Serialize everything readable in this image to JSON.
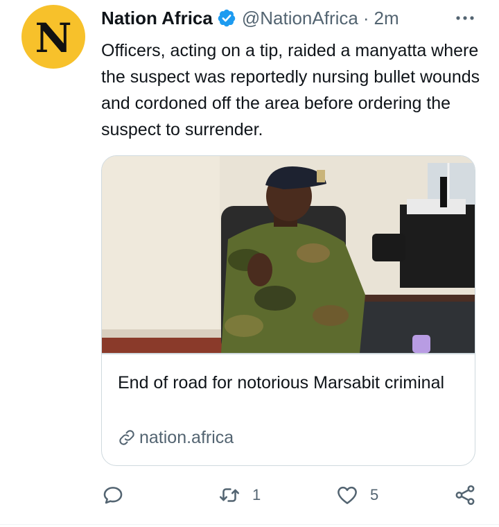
{
  "tweet": {
    "avatar_letter": "N",
    "author_name": "Nation Africa",
    "handle": "@NationAfrica",
    "separator": "·",
    "timestamp": "2m",
    "text": "Officers, acting on a tip, raided a manyatta where the suspect was reportedly nursing bullet wounds and cordoned off the area before ordering the suspect to surrender."
  },
  "card": {
    "title": "End of road for notorious Marsabit criminal",
    "domain": "nation.africa"
  },
  "actions": {
    "reply_count": "",
    "retweet_count": "1",
    "like_count": "5"
  },
  "colors": {
    "avatar_bg": "#f7c12b",
    "verified_blue": "#1d9bf0",
    "secondary_text": "#536471",
    "card_border": "#cfd9de"
  },
  "icons": [
    "verified-badge-icon",
    "more-icon",
    "link-icon",
    "reply-icon",
    "retweet-icon",
    "like-icon",
    "share-icon"
  ]
}
